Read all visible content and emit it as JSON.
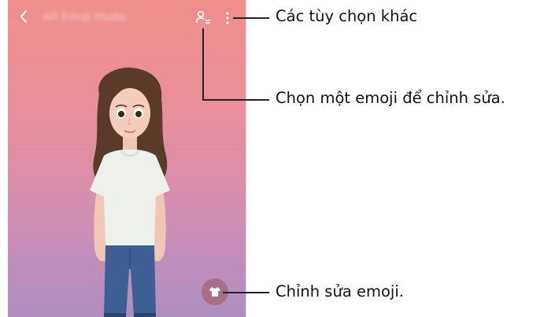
{
  "app_bar": {
    "title": "AR Emoji Studio",
    "back_icon": "chevron-left-icon",
    "select_icon": "person-list-icon",
    "more_icon": "vertical-dots-icon"
  },
  "edit_button": {
    "icon": "shirt-icon"
  },
  "callouts": {
    "more_options": "Các tùy chọn khác",
    "select_emoji": "Chọn một emoji để chỉnh sửa.",
    "edit_emoji": "Chỉnh sửa emoji."
  },
  "colors": {
    "background_top": "#ef8f8d",
    "background_bottom": "#ad8fc1",
    "edit_button": "#a96d86",
    "callout_line": "#222222"
  }
}
